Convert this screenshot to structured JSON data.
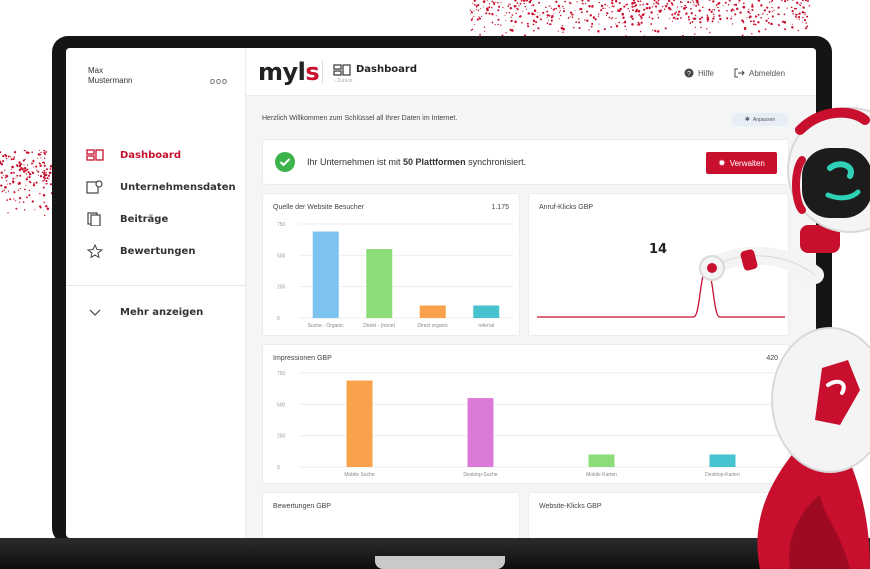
{
  "user": {
    "name_line1": "Max",
    "name_line2": "Mustermann",
    "menu": "ooo"
  },
  "sidebar": {
    "items": [
      {
        "label": "Dashboard",
        "icon": "dashboard-icon",
        "active": true
      },
      {
        "label": "Unternehmensdaten",
        "icon": "company-data-icon",
        "active": false
      },
      {
        "label": "Beiträge",
        "icon": "posts-icon",
        "active": false
      },
      {
        "label": "Bewertungen",
        "icon": "star-icon",
        "active": false
      }
    ],
    "more": "Mehr anzeigen"
  },
  "header": {
    "logo_main": "myl",
    "logo_accent": "s",
    "title": "Dashboard",
    "subtitle": "‹ Zurück",
    "help": "Hilfe",
    "logout": "Abmelden"
  },
  "welcome": {
    "text": "Herzlich Willkommen zum Schlüssel all Ihrer Daten im Internet.",
    "pill": "Anpassen"
  },
  "sync": {
    "prefix": "Ihr Unternehmen ist mit ",
    "bold": "50 Plattformen",
    "suffix": " synchronisiert.",
    "button": "Verwalten"
  },
  "colors": {
    "brand": "#c8102e",
    "success": "#3cb44b"
  },
  "chart_data": [
    {
      "type": "bar",
      "title": "Quelle der Website Besucher",
      "total": "1.175",
      "categories": [
        "Suche - Organic",
        "Direkt - (none)",
        "Direct organic",
        "referral"
      ],
      "values": [
        690,
        550,
        100,
        100
      ],
      "colors": [
        "#7cc4ef",
        "#8cdc7a",
        "#f9a24b",
        "#47c3cf"
      ],
      "ylim": [
        0,
        750
      ],
      "yticks": [
        0,
        250,
        500,
        750
      ]
    },
    {
      "type": "line",
      "title": "Anruf-Klicks GBP",
      "big_value": "14",
      "values": [
        0,
        0,
        0,
        0,
        0,
        0,
        0,
        0,
        0,
        0,
        0,
        0,
        0,
        14,
        0,
        0,
        0,
        0,
        0,
        0
      ]
    },
    {
      "type": "bar",
      "title": "Impressionen GBP",
      "total": "420",
      "categories": [
        "Mobile Suche",
        "Desktop-Suche",
        "Mobile Karten",
        "Desktop-Karten"
      ],
      "values": [
        690,
        550,
        100,
        100
      ],
      "colors": [
        "#f9a24b",
        "#da7ad6",
        "#8cdc7a",
        "#47c3cf"
      ],
      "ylim": [
        0,
        750
      ],
      "yticks": [
        0,
        250,
        500,
        750
      ]
    },
    {
      "type": "bar",
      "title": "Bewertungen GBP"
    },
    {
      "type": "line",
      "title": "Website-Klicks GBP"
    }
  ]
}
